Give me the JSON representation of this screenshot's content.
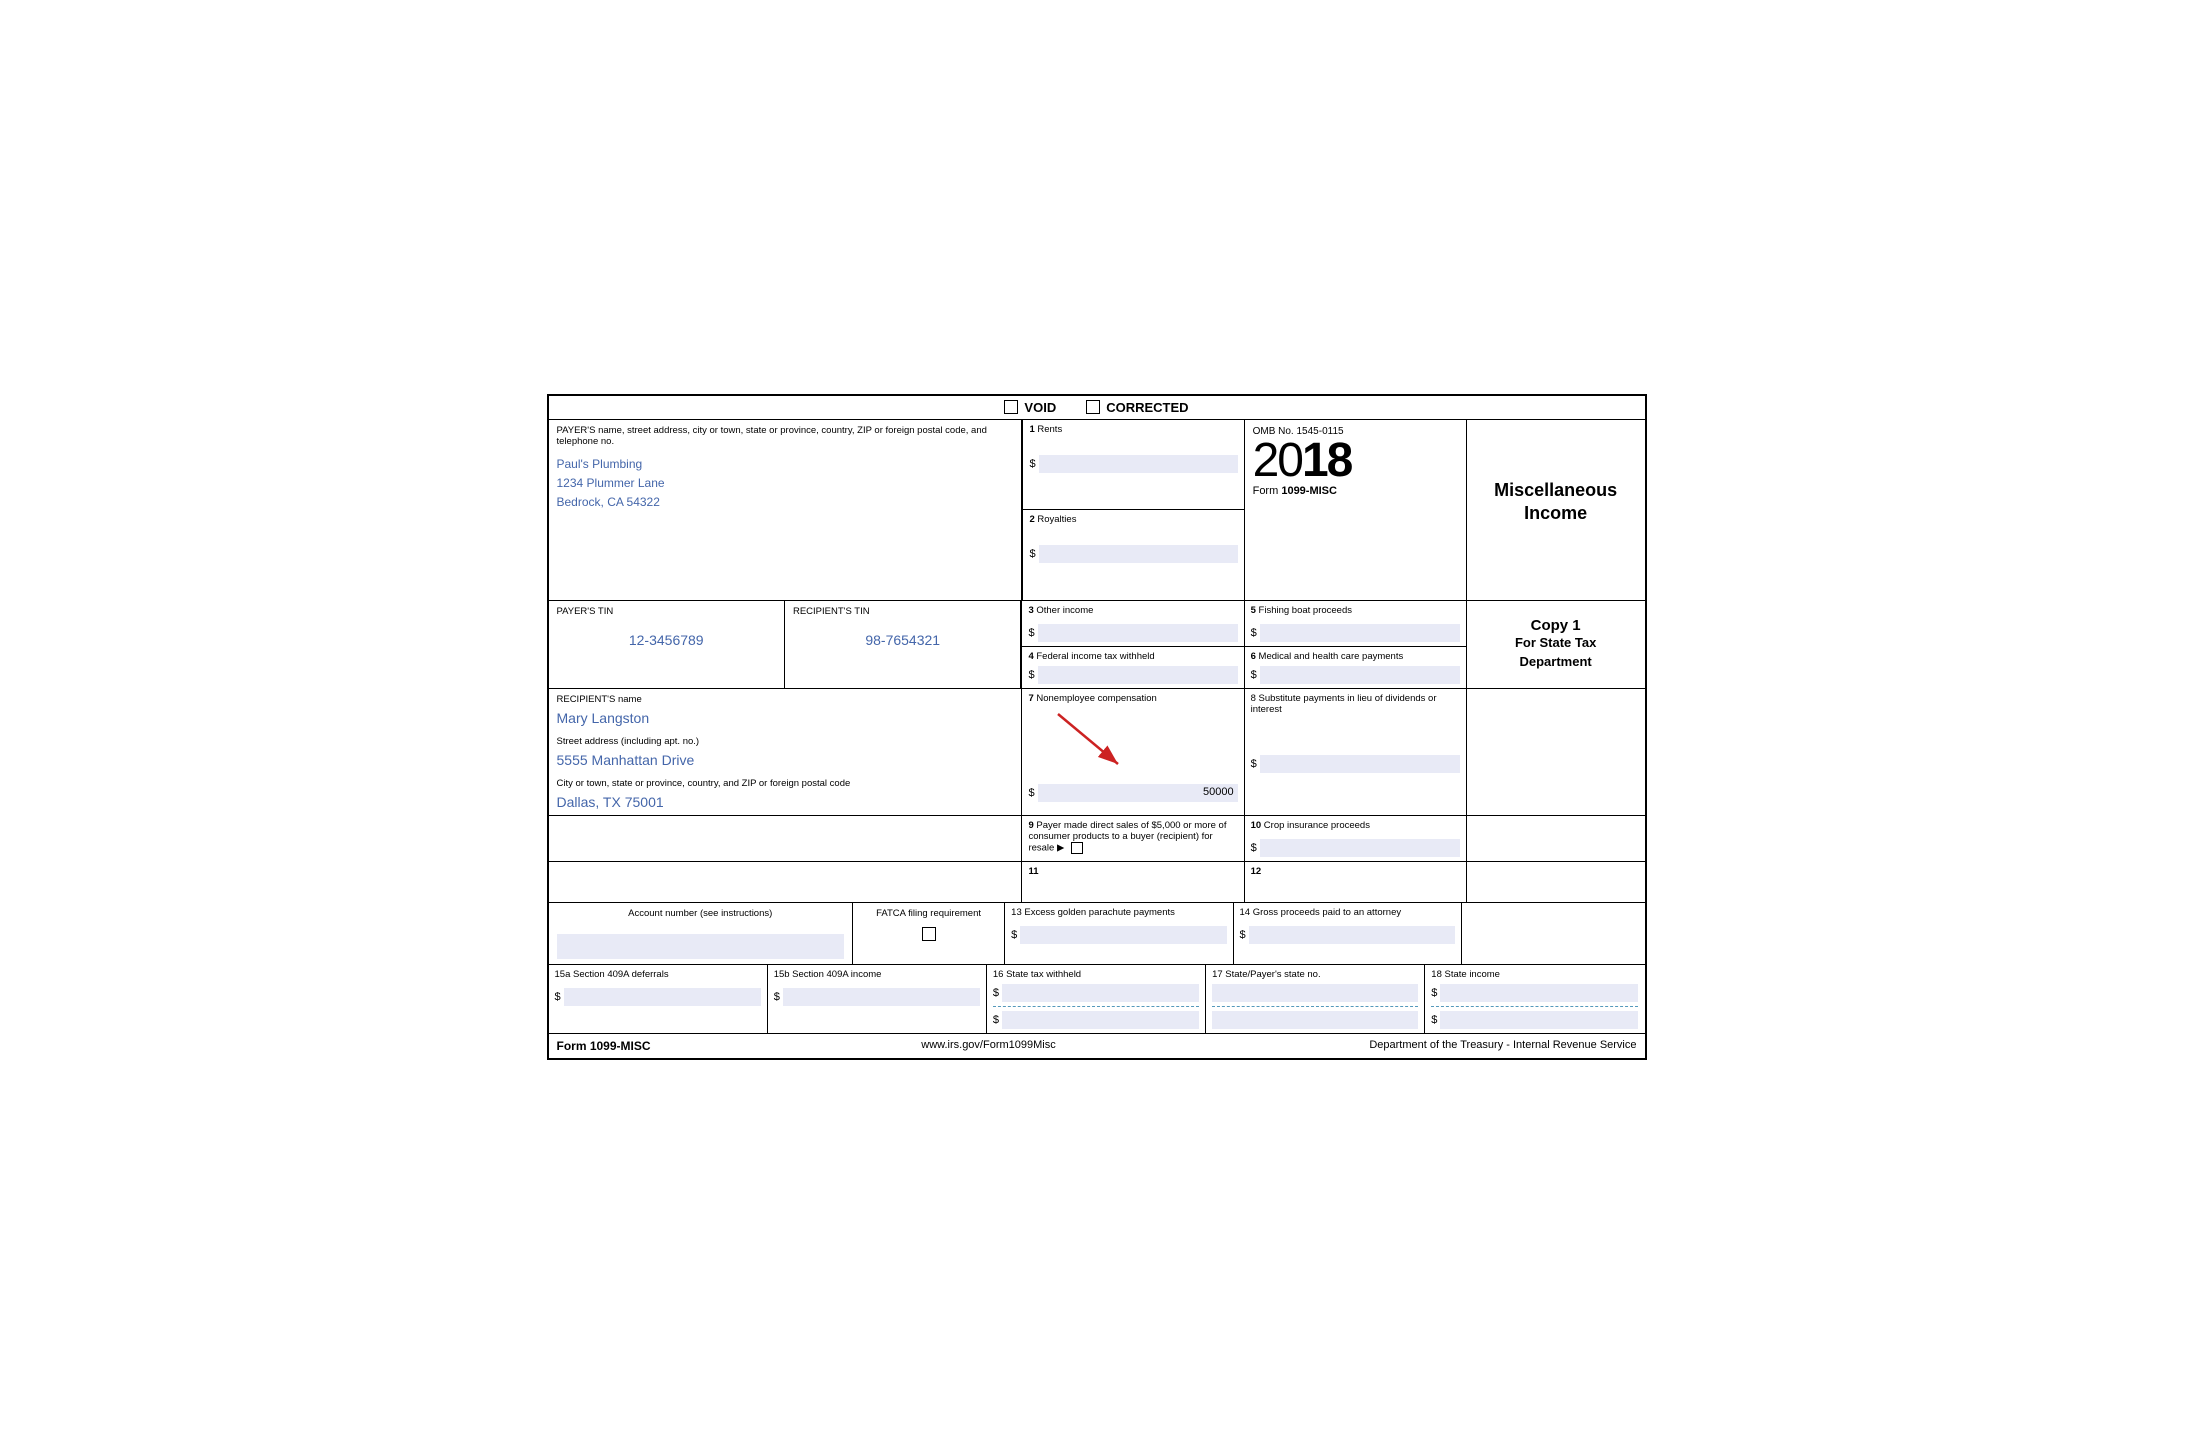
{
  "header": {
    "void_label": "VOID",
    "corrected_label": "CORRECTED"
  },
  "payer": {
    "field_label": "PAYER'S name, street address, city or town, state or province, country, ZIP or foreign postal code, and telephone no.",
    "name": "Paul's Plumbing",
    "address": "1234 Plummer Lane",
    "city_state_zip": "Bedrock, CA 54322"
  },
  "omb": {
    "label": "OMB No. 1545-0115",
    "year": "2018",
    "year_light": "20",
    "year_bold": "18",
    "form_label": "Form",
    "form_name": "1099-MISC"
  },
  "copy": {
    "misc_income_line1": "Miscellaneous",
    "misc_income_line2": "Income",
    "copy1_title": "Copy 1",
    "copy1_subtitle": "For State Tax Department"
  },
  "tin": {
    "payer_tin_label": "PAYER'S TIN",
    "payer_tin_value": "12-3456789",
    "recipient_tin_label": "RECIPIENT'S TIN",
    "recipient_tin_value": "98-7654321"
  },
  "recipient": {
    "name_label": "RECIPIENT'S name",
    "name_value": "Mary Langston",
    "street_label": "Street address (including apt. no.)",
    "street_value": "5555 Manhattan Drive",
    "city_label": "City or town, state or province, country, and ZIP or foreign postal code",
    "city_value": "Dallas, TX 75001"
  },
  "boxes": {
    "box1_label": "1 Rents",
    "box1_value": "",
    "box2_label": "2 Royalties",
    "box2_value": "",
    "box3_label": "3 Other income",
    "box3_value": "",
    "box4_label": "4 Federal income tax withheld",
    "box4_value": "",
    "box5_label": "5 Fishing boat proceeds",
    "box5_value": "",
    "box6_label": "6 Medical and health care payments",
    "box6_value": "",
    "box7_label": "7 Nonemployee compensation",
    "box7_value": "50000",
    "box8_label": "8 Substitute payments in lieu of dividends or interest",
    "box8_value": "",
    "box9_label": "9 Payer made direct sales of $5,000 or more of consumer products to a buyer (recipient) for resale",
    "box10_label": "10 Crop insurance proceeds",
    "box10_value": "",
    "box11_label": "11",
    "box12_label": "12",
    "box13_label": "13 Excess golden parachute payments",
    "box13_value": "",
    "box14_label": "14 Gross proceeds paid to an attorney",
    "box14_value": "",
    "box15a_label": "15a Section 409A deferrals",
    "box15a_value": "",
    "box15b_label": "15b Section 409A income",
    "box15b_value": "",
    "box16_label": "16 State tax withheld",
    "box16_value": "",
    "box17_label": "17 State/Payer's state no.",
    "box17_value": "",
    "box18_label": "18 State income",
    "box18_value": ""
  },
  "account": {
    "label": "Account number (see instructions)",
    "fatca_label": "FATCA filing requirement"
  },
  "footer": {
    "form_label": "Form 1099-MISC",
    "website": "www.irs.gov/Form1099Misc",
    "department": "Department of the Treasury - Internal Revenue Service"
  }
}
